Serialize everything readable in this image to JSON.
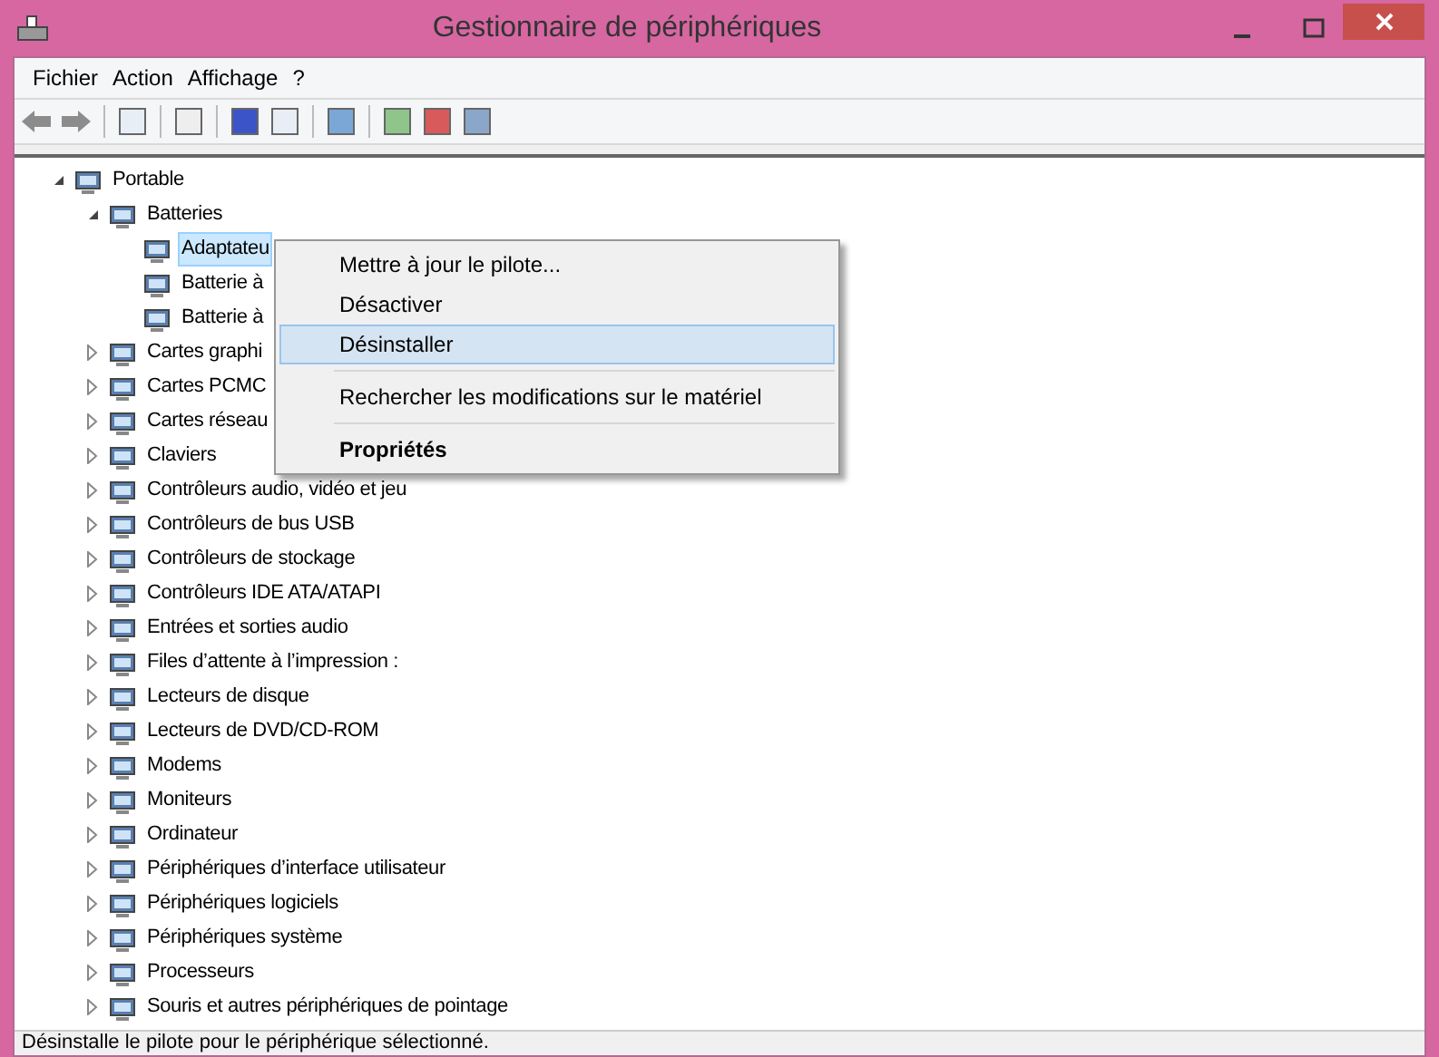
{
  "window": {
    "title": "Gestionnaire de périphériques"
  },
  "menu_bar": [
    "Fichier",
    "Action",
    "Affichage",
    "?"
  ],
  "tree": [
    {
      "label": "Portable",
      "expanded": true,
      "selected": false,
      "children": [
        {
          "label": "Batteries",
          "expanded": true,
          "selected": false,
          "children": [
            {
              "label": "Adaptateu",
              "selected": true
            },
            {
              "label": "Batterie à",
              "selected": false
            },
            {
              "label": "Batterie à",
              "selected": false
            }
          ]
        },
        {
          "label": "Cartes graphi",
          "expanded": false,
          "selected": false
        },
        {
          "label": "Cartes PCMC",
          "expanded": false,
          "selected": false
        },
        {
          "label": "Cartes réseau",
          "expanded": false,
          "selected": false
        },
        {
          "label": "Claviers",
          "expanded": false,
          "selected": false
        },
        {
          "label": "Contrôleurs audio, vidéo et jeu",
          "expanded": false,
          "selected": false
        },
        {
          "label": "Contrôleurs de bus USB",
          "expanded": false,
          "selected": false
        },
        {
          "label": "Contrôleurs de stockage",
          "expanded": false,
          "selected": false
        },
        {
          "label": "Contrôleurs IDE ATA/ATAPI",
          "expanded": false,
          "selected": false
        },
        {
          "label": "Entrées et sorties audio",
          "expanded": false,
          "selected": false
        },
        {
          "label": "Files d’attente à l’impression :",
          "expanded": false,
          "selected": false
        },
        {
          "label": "Lecteurs de disque",
          "expanded": false,
          "selected": false
        },
        {
          "label": "Lecteurs de DVD/CD-ROM",
          "expanded": false,
          "selected": false
        },
        {
          "label": "Modems",
          "expanded": false,
          "selected": false
        },
        {
          "label": "Moniteurs",
          "expanded": false,
          "selected": false
        },
        {
          "label": "Ordinateur",
          "expanded": false,
          "selected": false
        },
        {
          "label": "Périphériques d’interface utilisateur",
          "expanded": false,
          "selected": false
        },
        {
          "label": "Périphériques logiciels",
          "expanded": false,
          "selected": false
        },
        {
          "label": "Périphériques système",
          "expanded": false,
          "selected": false
        },
        {
          "label": "Processeurs",
          "expanded": false,
          "selected": false
        },
        {
          "label": "Souris et autres périphériques de pointage",
          "expanded": false,
          "selected": false
        }
      ]
    }
  ],
  "context_menu": [
    [
      {
        "label": "Mettre à jour le pilote...",
        "selected": false,
        "bold": false
      },
      {
        "label": "Désactiver",
        "selected": false,
        "bold": false
      },
      {
        "label": "Désinstaller",
        "selected": true,
        "bold": false
      }
    ],
    [
      {
        "label": "Rechercher les modifications sur le matériel",
        "selected": false,
        "bold": false
      }
    ],
    [
      {
        "label": "Propriétés",
        "selected": false,
        "bold": true
      }
    ]
  ],
  "status_bar": "Désinstalle le pilote pour le périphérique sélectionné."
}
